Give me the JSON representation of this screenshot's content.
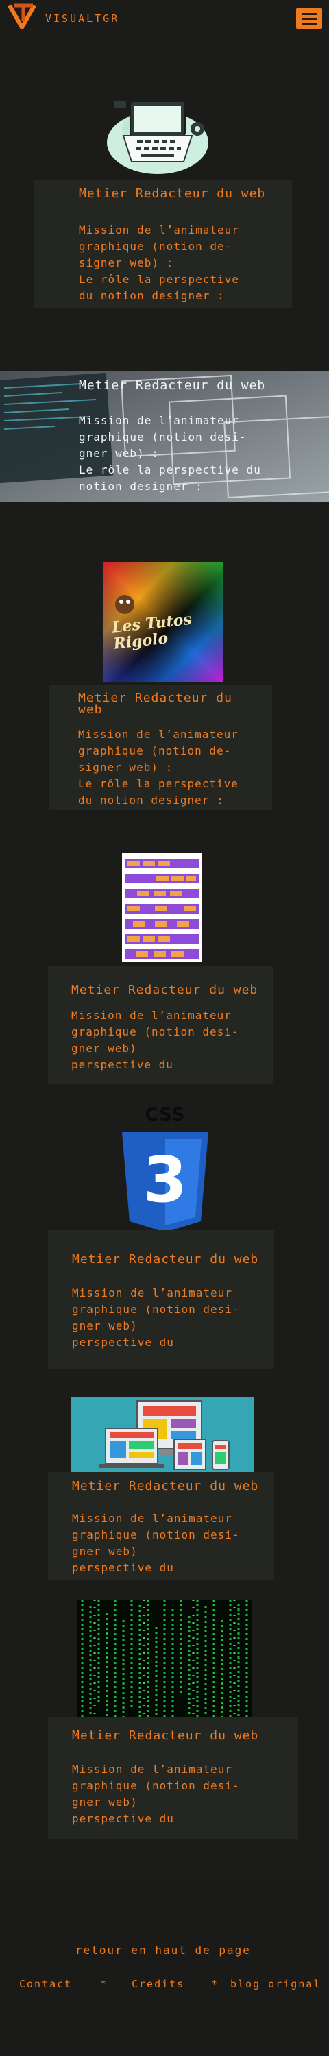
{
  "header": {
    "brand": "VISUALTGR",
    "logo_icon": "vt-logo-icon",
    "menu_icon": "hamburger-menu-icon"
  },
  "colors": {
    "accent": "#f07a1e",
    "background": "#1b1c1a",
    "panel": "#242622",
    "light_text": "#f4f4f4"
  },
  "cards": [
    {
      "title": "Metier Redacteur du web",
      "text": "Mission de l’animateur\ngraphique (notion de-\nsigner web) :\nLe rôle la perspective\ndu notion designer :"
    },
    {
      "title": "Metier Redacteur du web",
      "text": "Mission de l’animateur\ngraphique (notion desi-\ngner web) :\nLe rôle la perspective du\nnotion designer :"
    },
    {
      "title": "Metier Redacteur du web",
      "text": "Mission de l’animateur\ngraphique (notion de-\nsigner web) :\nLe rôle la perspective\ndu notion designer :"
    },
    {
      "title": "Metier Redacteur du web",
      "text": "Mission de l’animateur\ngraphique (notion desi-\ngner web)\nperspective du"
    },
    {
      "title": "Metier Redacteur du web",
      "text": "Mission de l’animateur\ngraphique (notion desi-\ngner web)\nperspective du"
    },
    {
      "title": "Metier Redacteur du web",
      "text": "Mission de l’animateur\ngraphique (notion desi-\ngner web)\nperspective du"
    },
    {
      "title": "Metier Redacteur du web",
      "text": "Mission de l’animateur\ngraphique (notion desi-\ngner web)\nperspective du"
    }
  ],
  "images": {
    "tutos_logo_text": "Les Tutos Rigolo",
    "css_label": "CSS",
    "css_number": "3"
  },
  "footer": {
    "back_to_top": "retour en haut de page",
    "links": [
      "Contact",
      "Credits",
      "blog orignal"
    ],
    "separator": "*"
  }
}
